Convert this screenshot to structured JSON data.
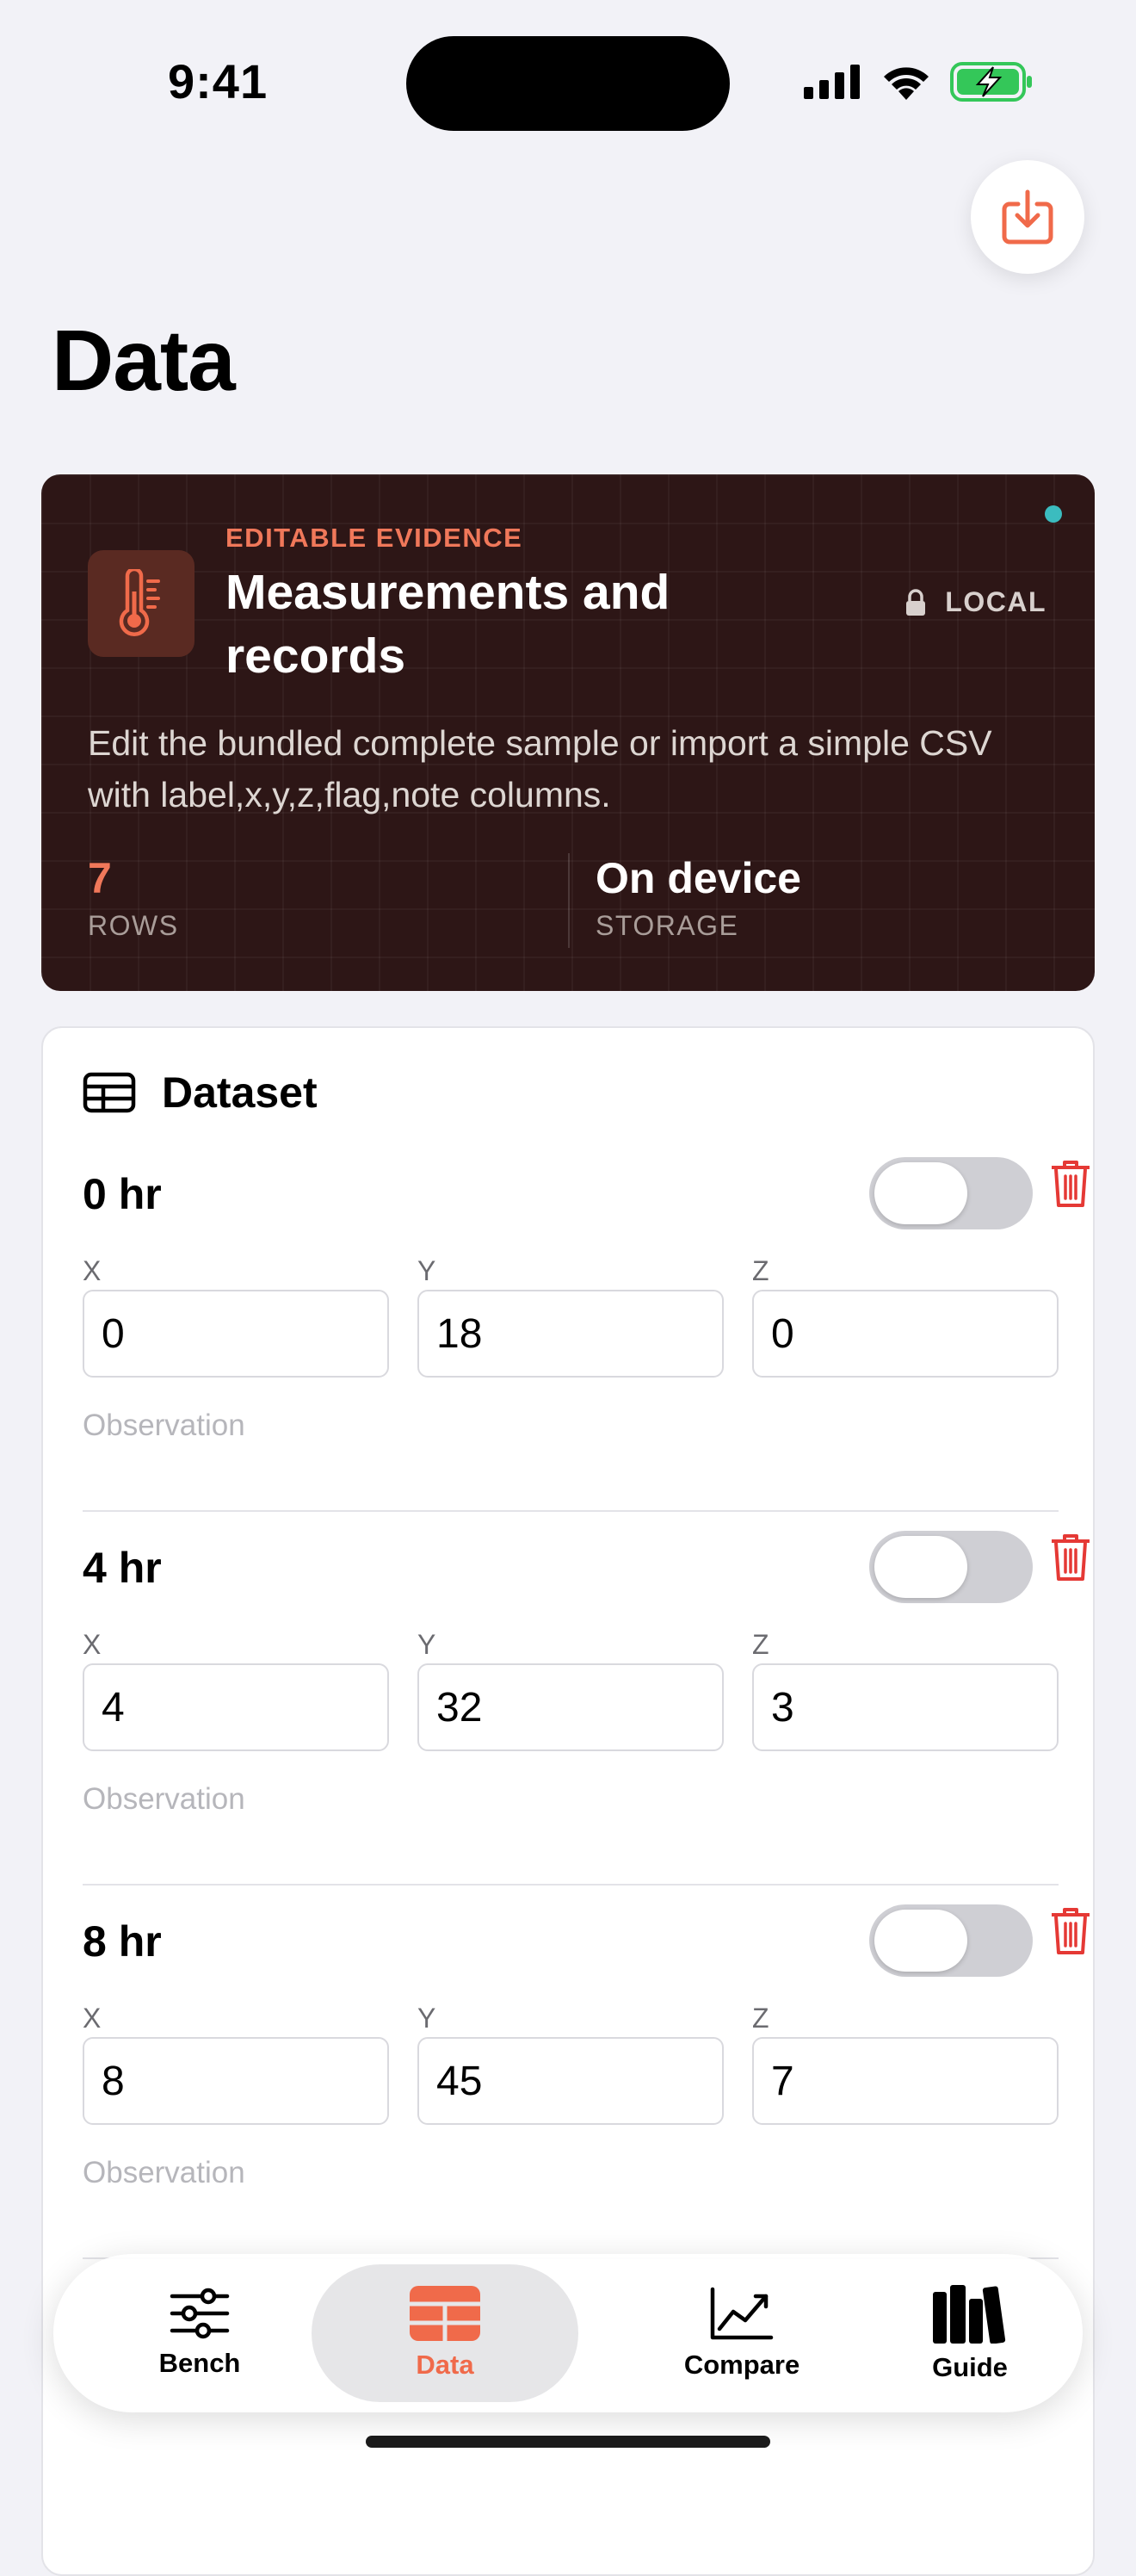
{
  "status": {
    "time": "9:41"
  },
  "page": {
    "title": "Data",
    "export_icon": "download-tray-icon"
  },
  "hero": {
    "kicker": "EDITABLE EVIDENCE",
    "title": "Measurements and records",
    "badge": "LOCAL",
    "description": "Edit the bundled complete sample or import a simple CSV with label,x,y,z,flag,note columns.",
    "stats": [
      {
        "value": "7",
        "label": "ROWS"
      },
      {
        "value": "On device",
        "label": "STORAGE"
      }
    ],
    "accent": "#f0785a",
    "background": "#2d1616",
    "dot_color": "#3bbcbf"
  },
  "dataset": {
    "title": "Dataset",
    "field_labels": {
      "x": "X",
      "y": "Y",
      "z": "Z"
    },
    "observation_placeholder": "Observation",
    "rows": [
      {
        "label": "0 hr",
        "x": "0",
        "y": "18",
        "z": "0",
        "flag": false
      },
      {
        "label": "4 hr",
        "x": "4",
        "y": "32",
        "z": "3",
        "flag": false
      },
      {
        "label": "8 hr",
        "x": "8",
        "y": "45",
        "z": "7",
        "flag": false
      }
    ]
  },
  "tabs": [
    {
      "label": "Bench",
      "icon": "sliders-icon",
      "active": false
    },
    {
      "label": "Data",
      "icon": "table-icon",
      "active": true
    },
    {
      "label": "Compare",
      "icon": "line-chart-icon",
      "active": false
    },
    {
      "label": "Guide",
      "icon": "books-icon",
      "active": false
    }
  ],
  "colors": {
    "accent": "#f06a4a",
    "danger": "#e53935"
  }
}
